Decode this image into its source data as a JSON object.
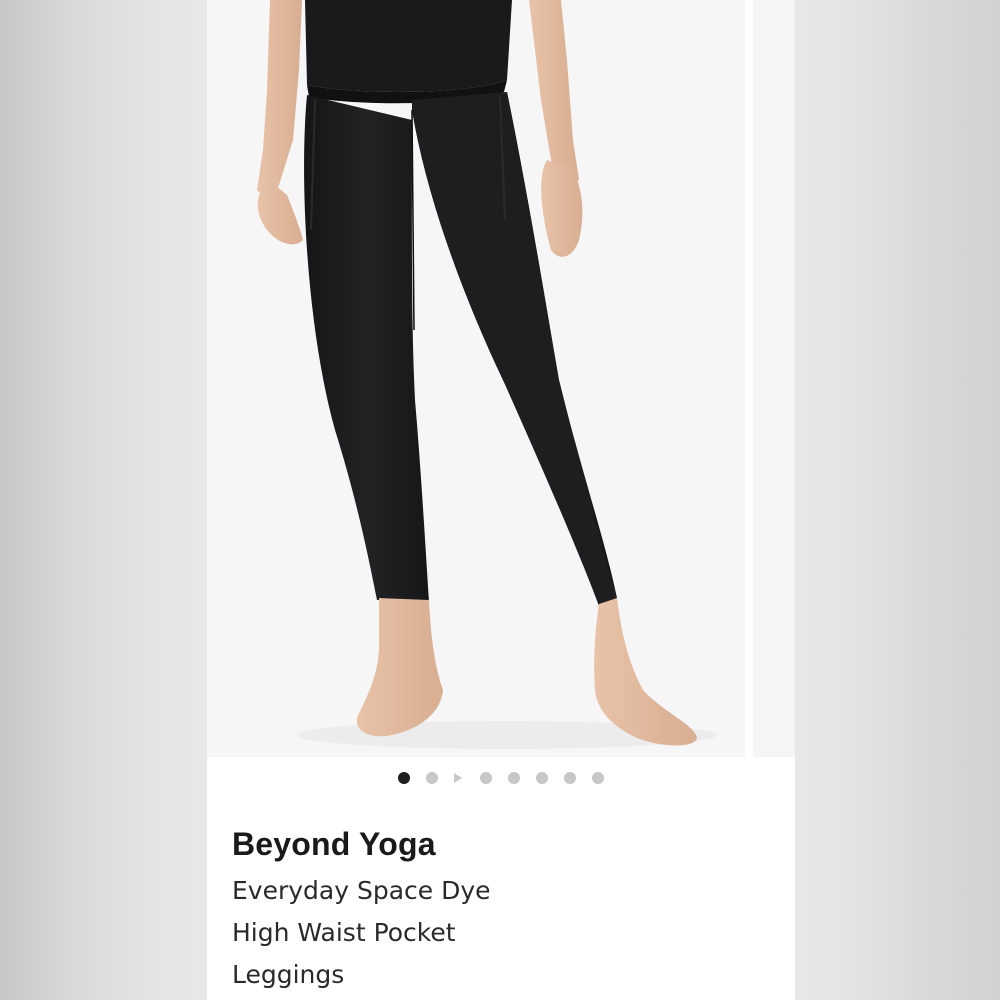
{
  "product": {
    "brand": "Beyond Yoga",
    "title_lines": [
      "Everyday Space Dye",
      "High Waist Pocket",
      "Leggings"
    ]
  },
  "gallery": {
    "total_items": 8,
    "active_index": 0,
    "video_index": 1,
    "photo_subject": "black high waist leggings on model"
  },
  "colors": {
    "legging": "#1d1d1f",
    "photo_bg": "#f6f6f6",
    "dot_active": "#1f1f1f",
    "dot_inactive": "#c7c7c7",
    "text": "#1a1a1a"
  },
  "icons": {
    "video": "play-triangle-icon"
  }
}
